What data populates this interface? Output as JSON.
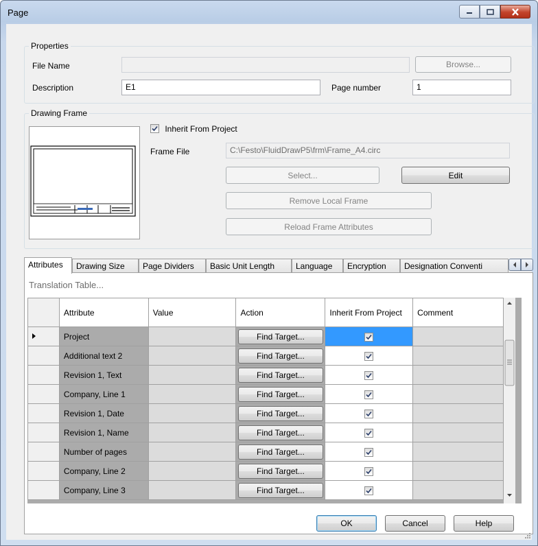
{
  "window": {
    "title": "Page"
  },
  "properties": {
    "group_label": "Properties",
    "file_name_label": "File Name",
    "file_name_value": "",
    "browse_label": "Browse...",
    "description_label": "Description",
    "description_value": "E1",
    "page_number_label": "Page number",
    "page_number_value": "1"
  },
  "drawing_frame": {
    "group_label": "Drawing Frame",
    "inherit_label": "Inherit From Project",
    "inherit_checked": true,
    "frame_file_label": "Frame File",
    "frame_file_value": "C:\\Festo\\FluidDrawP5\\frm\\Frame_A4.circ",
    "select_label": "Select...",
    "edit_label": "Edit",
    "remove_label": "Remove Local Frame",
    "reload_label": "Reload Frame Attributes"
  },
  "tabs": [
    "Attributes",
    "Drawing Size",
    "Page Dividers",
    "Basic Unit Length",
    "Language",
    "Encryption",
    "Designation Conventi"
  ],
  "active_tab": "Attributes",
  "translation_table_label": "Translation Table...",
  "grid": {
    "columns": [
      "Attribute",
      "Value",
      "Action",
      "Inherit From Project",
      "Comment"
    ],
    "find_target_label": "Find Target...",
    "rows": [
      {
        "attribute": "Project",
        "value": "",
        "inherit": true,
        "comment": ""
      },
      {
        "attribute": "Additional text 2",
        "value": "",
        "inherit": true,
        "comment": ""
      },
      {
        "attribute": "Revision 1, Text",
        "value": "",
        "inherit": true,
        "comment": ""
      },
      {
        "attribute": "Company, Line 1",
        "value": "",
        "inherit": true,
        "comment": ""
      },
      {
        "attribute": "Revision 1, Date",
        "value": "",
        "inherit": true,
        "comment": ""
      },
      {
        "attribute": "Revision 1, Name",
        "value": "",
        "inherit": true,
        "comment": ""
      },
      {
        "attribute": "Number of pages",
        "value": "",
        "inherit": true,
        "comment": ""
      },
      {
        "attribute": "Company, Line 2",
        "value": "",
        "inherit": true,
        "comment": ""
      },
      {
        "attribute": "Company, Line 3",
        "value": "",
        "inherit": true,
        "comment": ""
      }
    ]
  },
  "footer": {
    "ok_label": "OK",
    "cancel_label": "Cancel",
    "help_label": "Help"
  },
  "colors": {
    "selection": "#3399ff",
    "window_frame": "#b9cde6",
    "close_button": "#c2432a"
  }
}
